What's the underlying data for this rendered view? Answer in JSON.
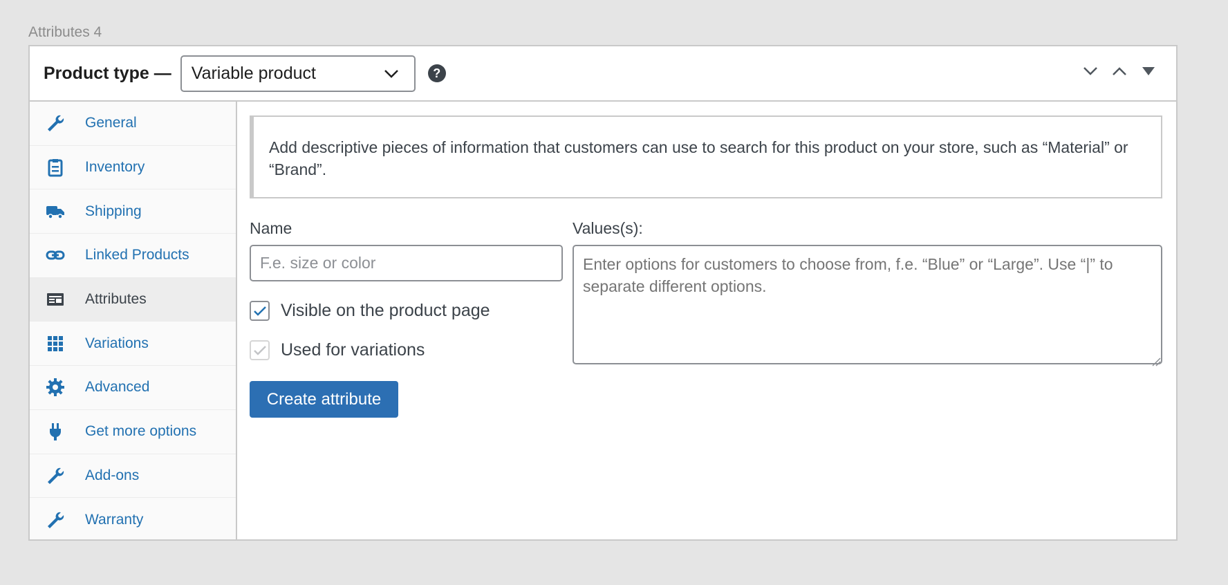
{
  "caption": "Attributes 4",
  "header": {
    "product_type_label": "Product type —",
    "product_type_value": "Variable product"
  },
  "sidebar": {
    "items": [
      {
        "label": "General",
        "icon": "wrench-icon"
      },
      {
        "label": "Inventory",
        "icon": "clipboard-icon"
      },
      {
        "label": "Shipping",
        "icon": "truck-icon"
      },
      {
        "label": "Linked Products",
        "icon": "link-icon"
      },
      {
        "label": "Attributes",
        "icon": "attributes-icon",
        "active": true
      },
      {
        "label": "Variations",
        "icon": "grid-icon"
      },
      {
        "label": "Advanced",
        "icon": "gear-icon"
      },
      {
        "label": "Get more options",
        "icon": "plug-icon"
      },
      {
        "label": "Add-ons",
        "icon": "wrench-icon"
      },
      {
        "label": "Warranty",
        "icon": "wrench-icon"
      }
    ]
  },
  "main": {
    "notice": "Add descriptive pieces of information that customers can use to search for this product on your store, such as “Material” or “Brand”.",
    "name_label": "Name",
    "name_placeholder": "F.e. size or color",
    "values_label": "Values(s):",
    "values_placeholder": "Enter options for customers to choose from, f.e. “Blue” or “Large”. Use “|” to separate different options.",
    "visible_label": "Visible on the product page",
    "visible_checked": true,
    "variations_label": "Used for variations",
    "variations_checked": true,
    "create_button": "Create attribute"
  },
  "colors": {
    "accent": "#2271b1",
    "button": "#2c6fb3"
  }
}
